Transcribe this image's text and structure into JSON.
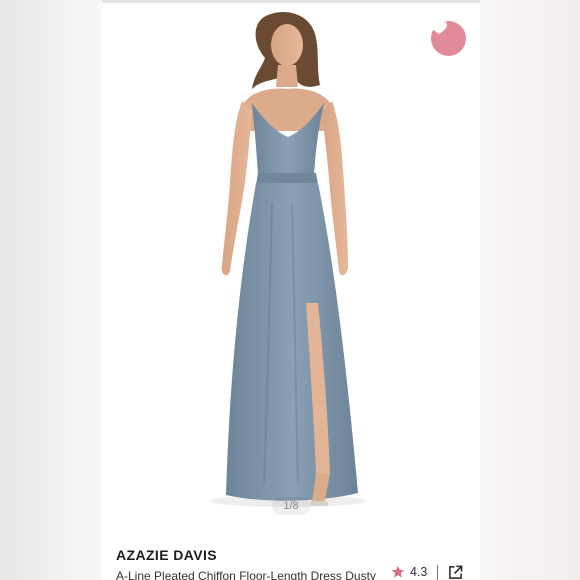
{
  "listing": {
    "brand": "AZAZIE DAVIS",
    "title": "A-Line Pleated Chiffon Floor-Length Dress Dusty",
    "rating": "4.3",
    "image_counter": "1/8"
  },
  "icons": {
    "favorite": "heart-icon",
    "rating": "star-icon",
    "share": "external-link-icon"
  },
  "colors": {
    "favorite_bg": "#e28b98",
    "dress": "#7d93a8",
    "star": "#d9707f"
  }
}
